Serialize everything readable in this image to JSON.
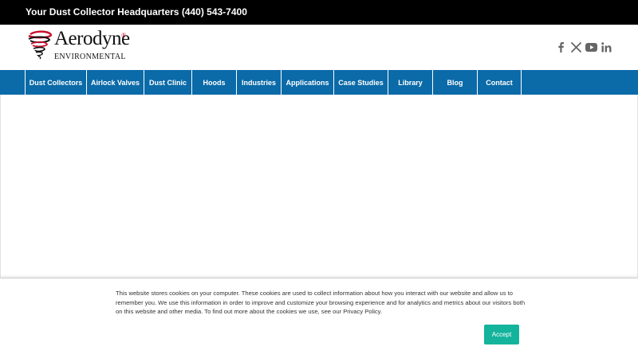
{
  "topbar": {
    "text": "Your Dust Collector Headquarters (440) 543-7400"
  },
  "logo": {
    "name": "Aerodyne",
    "registered": "®",
    "subtitle": "ENVIRONMENTAL",
    "brand_color": "#c8102e"
  },
  "social": [
    {
      "icon": "facebook-icon"
    },
    {
      "icon": "x-icon"
    },
    {
      "icon": "youtube-icon"
    },
    {
      "icon": "linkedin-icon"
    }
  ],
  "nav": {
    "background": "#0b6aa8",
    "items": [
      {
        "label": "Dust Collectors"
      },
      {
        "label": "Airlock Valves"
      },
      {
        "label": "Dust Clinic"
      },
      {
        "label": "Hoods"
      },
      {
        "label": "Industries"
      },
      {
        "label": "Applications"
      },
      {
        "label": "Case Studies"
      },
      {
        "label": "Library"
      },
      {
        "label": "Blog"
      },
      {
        "label": "Contact"
      }
    ]
  },
  "cookie": {
    "text": "This website stores cookies on your computer. These cookies are used to collect information about how you interact with our website and allow us to remember you. We use this information in order to improve and customize your browsing experience and for analytics and metrics about our visitors both on this website and other media. To find out more about the cookies we use, see our Privacy Policy.",
    "accept_label": "Accept",
    "accept_color": "#14b39c"
  }
}
